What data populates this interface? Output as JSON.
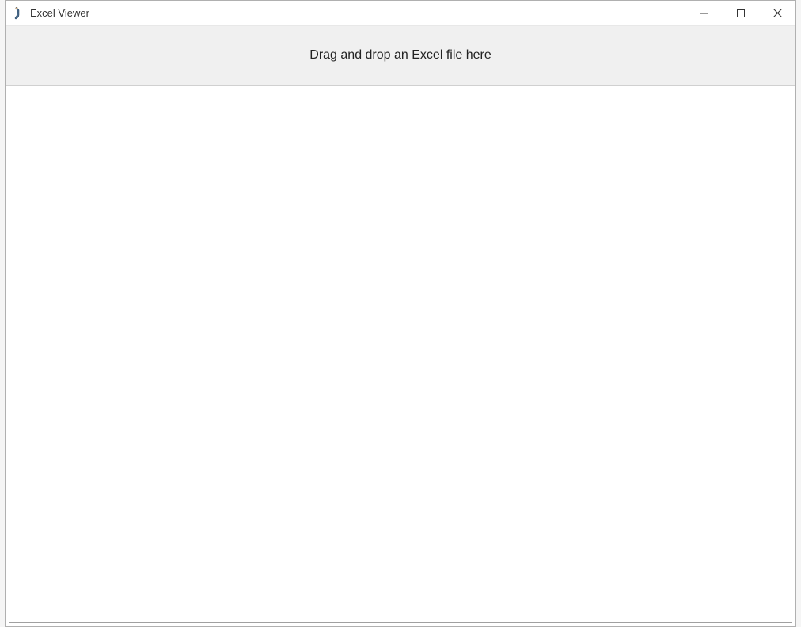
{
  "window": {
    "title": "Excel Viewer"
  },
  "dropzone": {
    "message": "Drag and drop an Excel file here"
  }
}
